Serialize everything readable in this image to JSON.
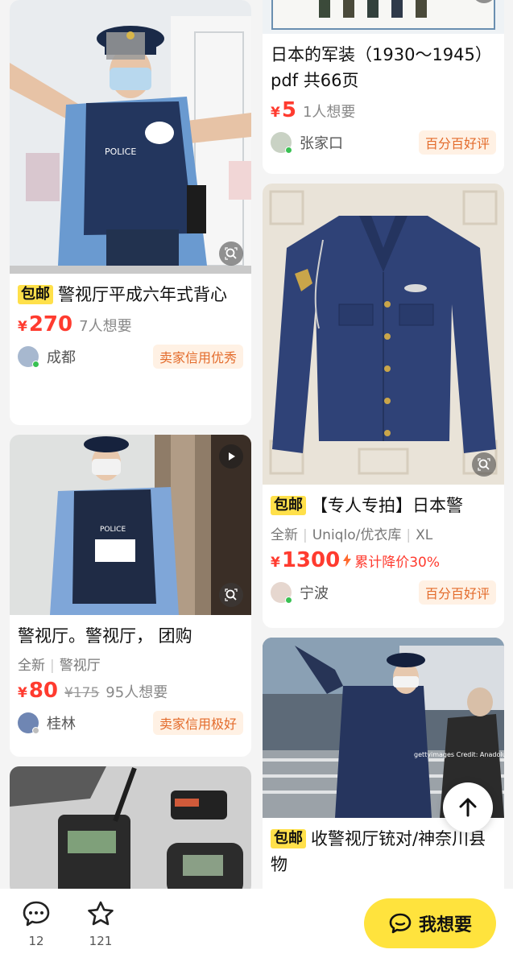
{
  "left_column": [
    {
      "title": "警视厅平成六年式背心",
      "free_shipping": "包邮",
      "price_yen": "¥",
      "price": "270",
      "wants": "7人想要",
      "city": "成都",
      "badge": "卖家信用优秀"
    },
    {
      "title": "警视厅。警视厅， 团购",
      "attrs": [
        "全新",
        "警视厅"
      ],
      "price_yen": "¥",
      "price": "80",
      "original_price": "¥175",
      "wants": "95人想要",
      "city": "桂林",
      "badge": "卖家信用极好"
    }
  ],
  "right_column": [
    {
      "title": "日本的军装（1930～1945）pdf 共66页",
      "price_yen": "¥",
      "price": "5",
      "wants": "1人想要",
      "city": "张家口",
      "badge": "百分百好评"
    },
    {
      "title": "【专人专拍】日本警",
      "free_shipping": "包邮",
      "attrs": [
        "全新",
        "Uniqlo/优衣库",
        "XL"
      ],
      "price_yen": "¥",
      "price": "1300",
      "price_cut": "累计降价30%",
      "city": "宁波",
      "badge": "百分百好评"
    },
    {
      "title": "收警视厅铳对/神奈川县物",
      "free_shipping": "包邮",
      "photo_watermark": "gettyimages Credit: Anadolu"
    }
  ],
  "bottom_bar": {
    "comments_count": "12",
    "favorites_count": "121",
    "want_button": "我想要"
  },
  "colors": {
    "price_red": "#ff3b2f",
    "tag_yellow": "#ffe04a",
    "badge_orange": "#e36b2b",
    "button_yellow": "#ffe33d",
    "online_green": "#39c153"
  }
}
